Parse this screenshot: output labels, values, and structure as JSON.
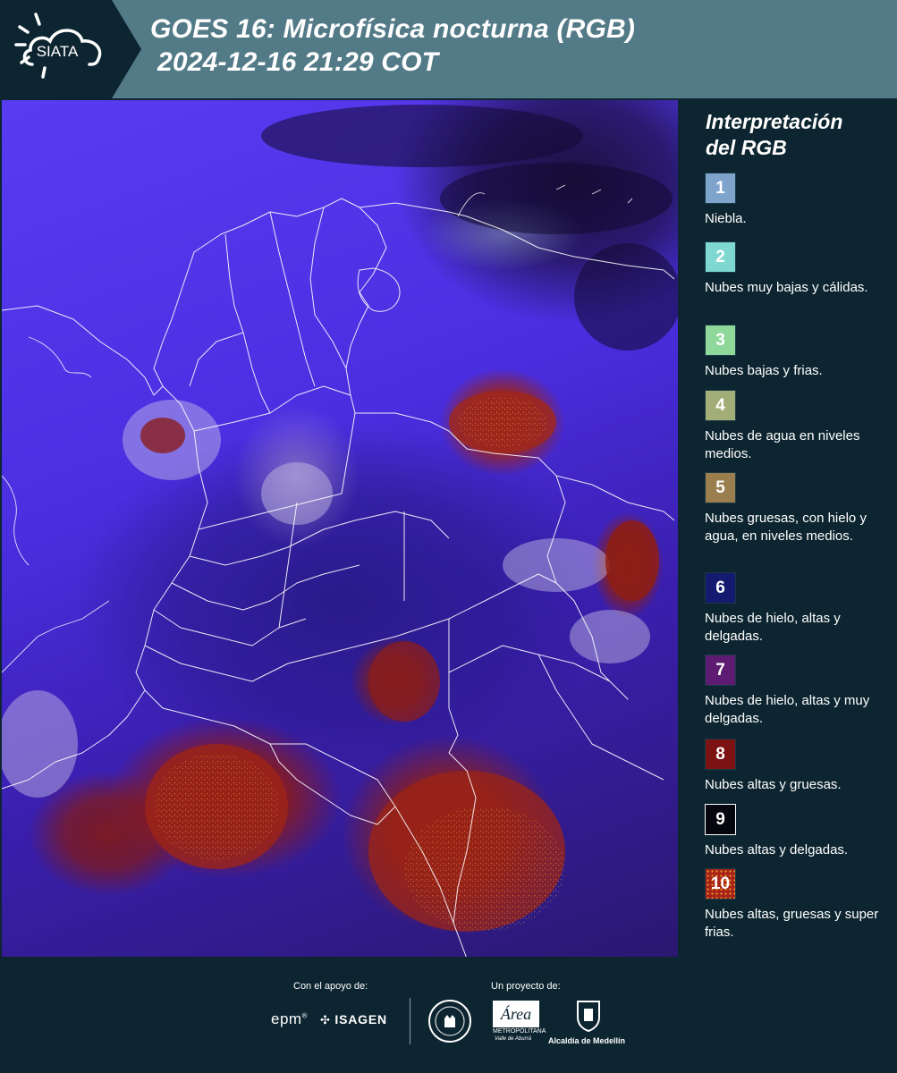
{
  "header": {
    "logo_text": "SIATA",
    "title_line1": "GOES 16: Microfísica nocturna (RGB)",
    "title_line2": "2024-12-16 21:29 COT"
  },
  "map": {
    "icon": "satellite-rgb-image",
    "boundary_color": "#ffffff"
  },
  "legend": {
    "title_line1": "Interpretación",
    "title_line2": "del RGB",
    "items": [
      {
        "number": "1",
        "label": "Niebla.",
        "color": "#7ea4cc"
      },
      {
        "number": "2",
        "label": "Nubes muy bajas y cálidas.",
        "color": "#7fd7d2"
      },
      {
        "number": "3",
        "label": "Nubes bajas y frias.",
        "color": "#8ed89a"
      },
      {
        "number": "4",
        "label": "Nubes de agua en niveles medios.",
        "color": "#a3ad78"
      },
      {
        "number": "5",
        "label": "Nubes gruesas, con hielo y agua, en niveles medios.",
        "color": "#9a7e4e"
      },
      {
        "number": "6",
        "label": "Nubes de hielo, altas y delgadas.",
        "color": "#141a70"
      },
      {
        "number": "7",
        "label": "Nubes de hielo, altas y muy delgadas.",
        "color": "#5e1b72"
      },
      {
        "number": "8",
        "label": "Nubes altas y gruesas.",
        "color": "#7d1212"
      },
      {
        "number": "9",
        "label": "Nubes altas y delgadas.",
        "color": "#06060e"
      },
      {
        "number": "10",
        "label": "Nubes altas, gruesas y super frias.",
        "color": "#a8221a"
      }
    ]
  },
  "footer": {
    "support_caption": "Con el apoyo de:",
    "project_caption": "Un proyecto de:",
    "sponsor_epm": "epm",
    "sponsor_isagen": "ISAGEN",
    "partner_metropolitana_line1": "METROPOLITANA",
    "partner_metropolitana_line2": "Valle de Aburrá",
    "partner_area": "Área",
    "partner_medellin": "Alcaldía de Medellín"
  }
}
